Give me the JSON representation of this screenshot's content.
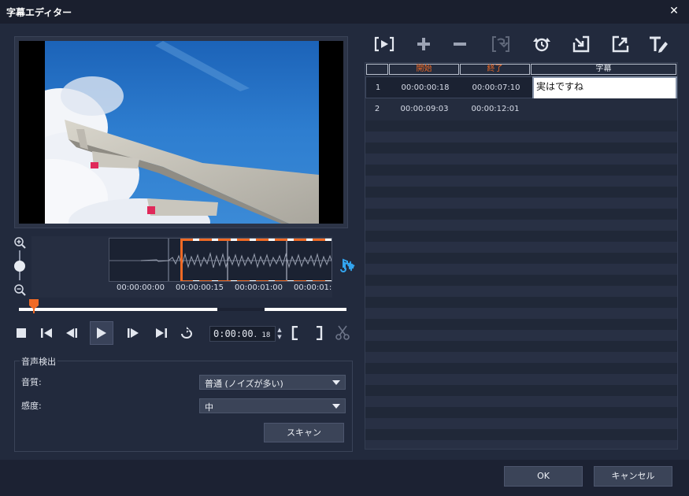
{
  "window": {
    "title": "字幕エディター",
    "close_label": "✕"
  },
  "preview": {
    "timeline_labels": [
      "00:00:00:00",
      "00:00:00:15",
      "00:00:01:00",
      "00:00:01:"
    ]
  },
  "transport": {
    "timecode": "0:00:00",
    "timecode_frames": "18"
  },
  "audio_detect": {
    "group_label": "音声検出",
    "quality_label": "音質:",
    "quality_value": "普通 (ノイズが多い)",
    "sensitivity_label": "感度:",
    "sensitivity_value": "中",
    "scan_label": "スキャン"
  },
  "grid": {
    "headers": [
      "開始",
      "終了",
      "字幕"
    ],
    "rows": [
      {
        "num": "1",
        "start": "00:00:00:18",
        "end": "00:00:07:10",
        "text": "実はですね"
      },
      {
        "num": "2",
        "start": "00:00:09:03",
        "end": "00:00:12:01",
        "text": ""
      }
    ]
  },
  "footer": {
    "ok_label": "OK",
    "cancel_label": "キャンセル"
  },
  "colors": {
    "accent_orange": "#f06a25",
    "panel": "#222a3d",
    "icon_blue": "#33a4ee"
  }
}
